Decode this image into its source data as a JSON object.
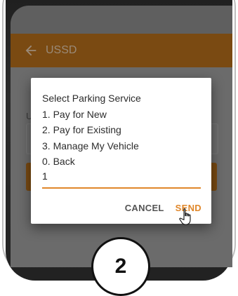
{
  "app": {
    "title": "USSD"
  },
  "dialog": {
    "lines": [
      "Select Parking Service",
      "1. Pay for New",
      "2. Pay for Existing",
      "3. Manage My Vehicle",
      "0. Back"
    ],
    "input_value": "1",
    "cancel_label": "CANCEL",
    "send_label": "SEND"
  },
  "background": {
    "label_fragment": "U"
  },
  "step": {
    "number": "2"
  },
  "colors": {
    "appbar": "#7a4a12",
    "accent": "#e0872a",
    "dim_overlay": "#5f5f5f"
  },
  "icons": {
    "back": "arrow-left-icon",
    "cursor": "hand-pointer-icon"
  }
}
